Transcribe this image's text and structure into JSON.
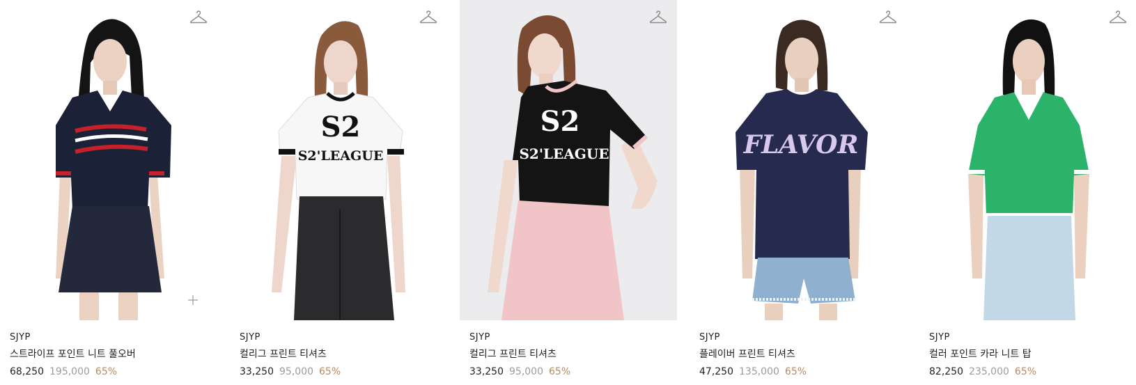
{
  "products": [
    {
      "brand": "SJYP",
      "name": "스트라이프 포인트 니트 풀오버",
      "price": "68,250",
      "original_price": "195,000",
      "discount": "65%",
      "top_color": "#1b2238",
      "bottom_color": "#23283a",
      "bg_color": "#ffffff"
    },
    {
      "brand": "SJYP",
      "name": "컬리그 프린트 티셔츠",
      "price": "33,250",
      "original_price": "95,000",
      "discount": "65%",
      "top_color": "#f7f7f7",
      "bottom_color": "#2b2b2e",
      "bg_color": "#ffffff"
    },
    {
      "brand": "SJYP",
      "name": "컬리그 프린트 티셔츠",
      "price": "33,250",
      "original_price": "95,000",
      "discount": "65%",
      "top_color": "#141414",
      "bottom_color": "#f1c4c8",
      "bg_color": "#ececee"
    },
    {
      "brand": "SJYP",
      "name": "플레이버 프린트 티셔츠",
      "price": "47,250",
      "original_price": "135,000",
      "discount": "65%",
      "top_color": "#262a4f",
      "bottom_color": "#8fb0cf",
      "bg_color": "#ffffff"
    },
    {
      "brand": "SJYP",
      "name": "컬러 포인트 카라 니트 탑",
      "price": "82,250",
      "original_price": "235,000",
      "discount": "65%",
      "top_color": "#2bb36a",
      "bottom_color": "#c3d8e6",
      "bg_color": "#ffffff"
    }
  ],
  "print_text": {
    "s2": "S2",
    "league": "S2'LEAGUE",
    "flavor": "FLAVOR"
  }
}
